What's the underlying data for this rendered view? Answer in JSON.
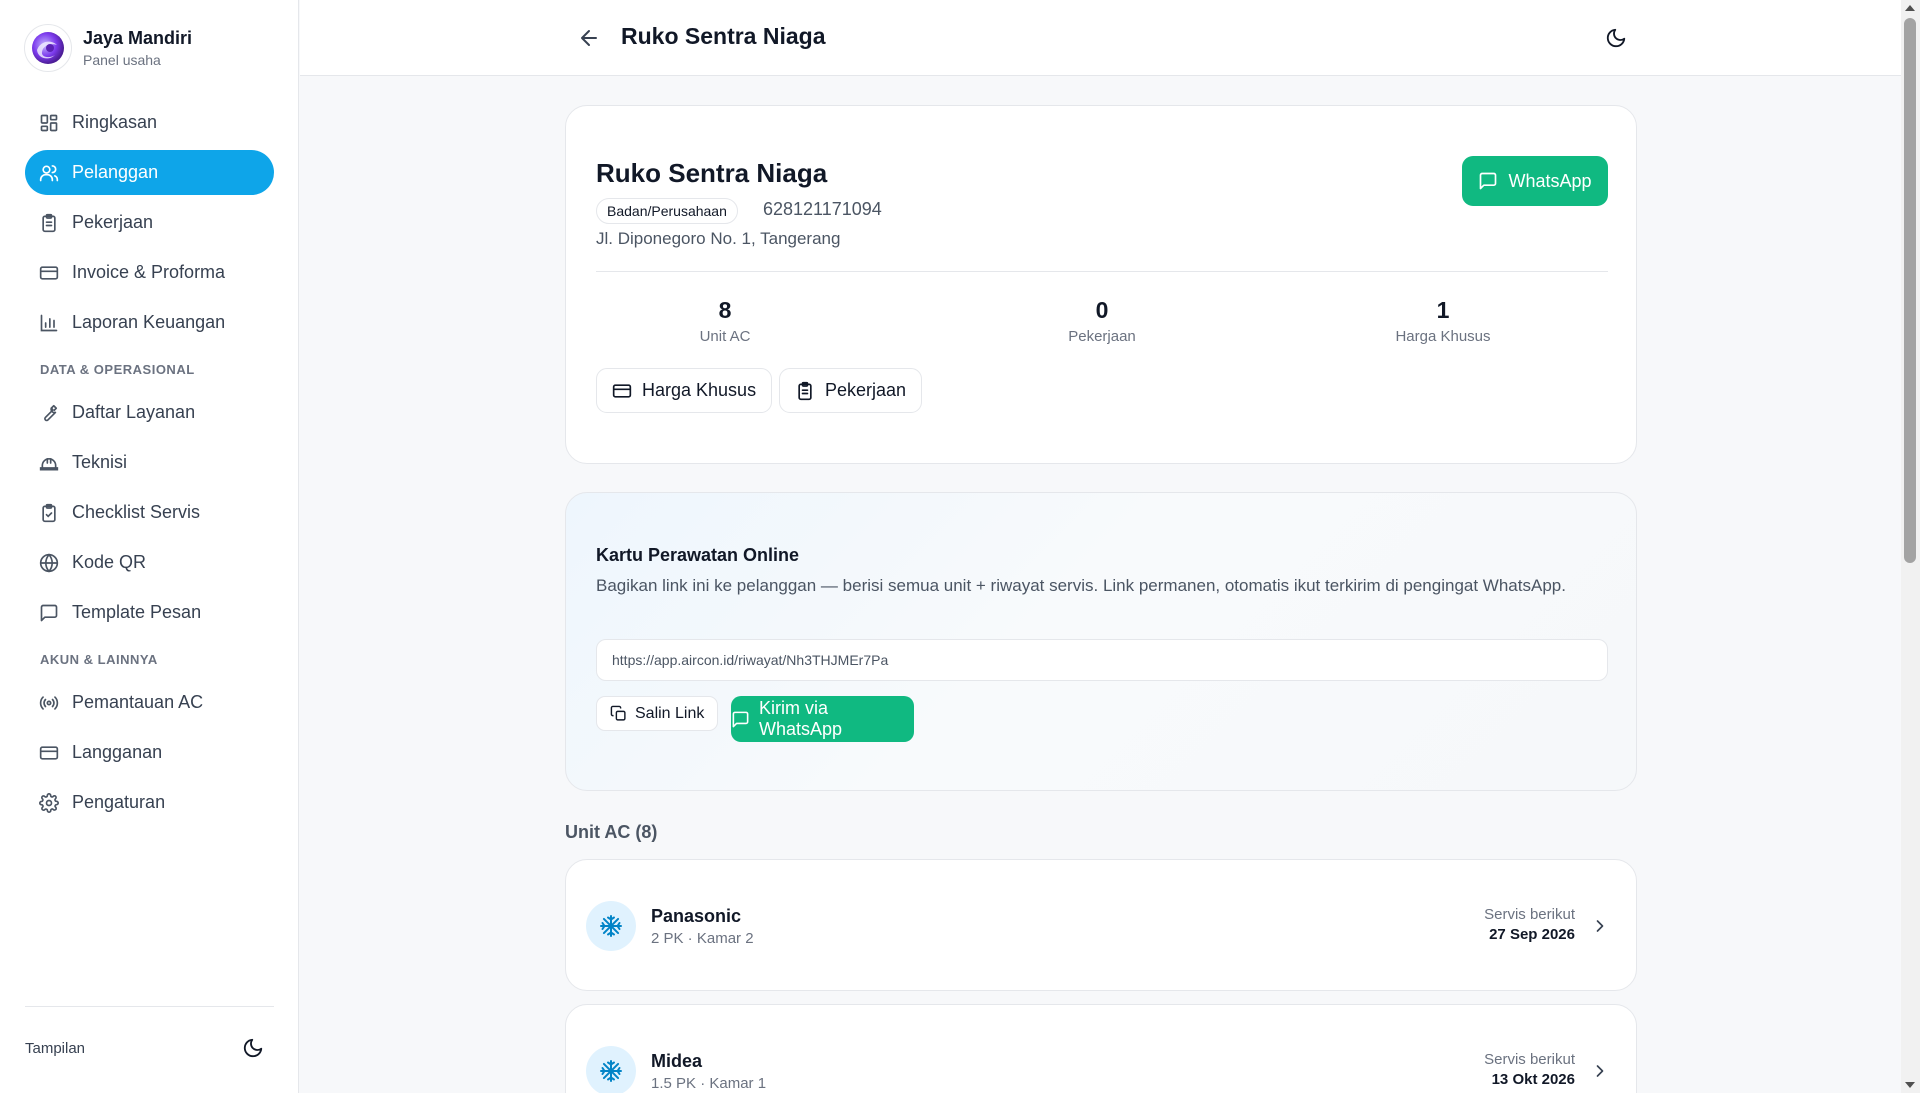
{
  "brand": {
    "name": "Jaya Mandiri",
    "subtitle": "Panel usaha"
  },
  "sidebar": {
    "items": [
      {
        "label": "Ringkasan",
        "icon": "dashboard-icon",
        "active": false
      },
      {
        "label": "Pelanggan",
        "icon": "users-icon",
        "active": true
      },
      {
        "label": "Pekerjaan",
        "icon": "clipboard-icon",
        "active": false
      },
      {
        "label": "Invoice & Proforma",
        "icon": "credit-card-icon",
        "active": false
      },
      {
        "label": "Laporan Keuangan",
        "icon": "bar-chart-icon",
        "active": false
      }
    ],
    "section_data": "DATA & OPERASIONAL",
    "data_items": [
      {
        "label": "Daftar Layanan",
        "icon": "wrench-icon"
      },
      {
        "label": "Teknisi",
        "icon": "hard-hat-icon"
      },
      {
        "label": "Checklist Servis",
        "icon": "clipboard-check-icon"
      },
      {
        "label": "Kode QR",
        "icon": "globe-icon"
      },
      {
        "label": "Template Pesan",
        "icon": "message-square-icon"
      }
    ],
    "section_account": "AKUN & LAINNYA",
    "account_items": [
      {
        "label": "Pemantauan AC",
        "icon": "radio-icon"
      },
      {
        "label": "Langganan",
        "icon": "credit-card-icon"
      },
      {
        "label": "Pengaturan",
        "icon": "gear-icon"
      }
    ],
    "footer_label": "Tampilan"
  },
  "header": {
    "title": "Ruko Sentra Niaga"
  },
  "profile": {
    "name": "Ruko Sentra Niaga",
    "type_badge": "Badan/Perusahaan",
    "phone": "628121171094",
    "address": "Jl. Diponegoro No. 1, Tangerang",
    "whatsapp_label": "WhatsApp",
    "stats": [
      {
        "value": "8",
        "label": "Unit AC"
      },
      {
        "value": "0",
        "label": "Pekerjaan"
      },
      {
        "value": "1",
        "label": "Harga Khusus"
      }
    ],
    "buttons": {
      "special_price": "Harga Khusus",
      "jobs": "Pekerjaan"
    }
  },
  "care_card": {
    "title": "Kartu Perawatan Online",
    "description": "Bagikan link ini ke pelanggan — berisi semua unit + riwayat servis. Link permanen, otomatis ikut terkirim di pengingat WhatsApp.",
    "link": "https://app.aircon.id/riwayat/Nh3THJMEr7Pa",
    "copy_label": "Salin Link",
    "send_label": "Kirim via WhatsApp"
  },
  "units": {
    "heading": "Unit AC (8)",
    "next_label": "Servis berikut",
    "items": [
      {
        "brand": "Panasonic",
        "detail": "2 PK · Kamar 2",
        "next_date": "27 Sep 2026"
      },
      {
        "brand": "Midea",
        "detail": "1.5 PK · Kamar 1",
        "next_date": "13 Okt 2026"
      }
    ]
  },
  "colors": {
    "accent": "#0ea5e9",
    "whatsapp": "#10b981",
    "background": "#f7f8fa"
  }
}
